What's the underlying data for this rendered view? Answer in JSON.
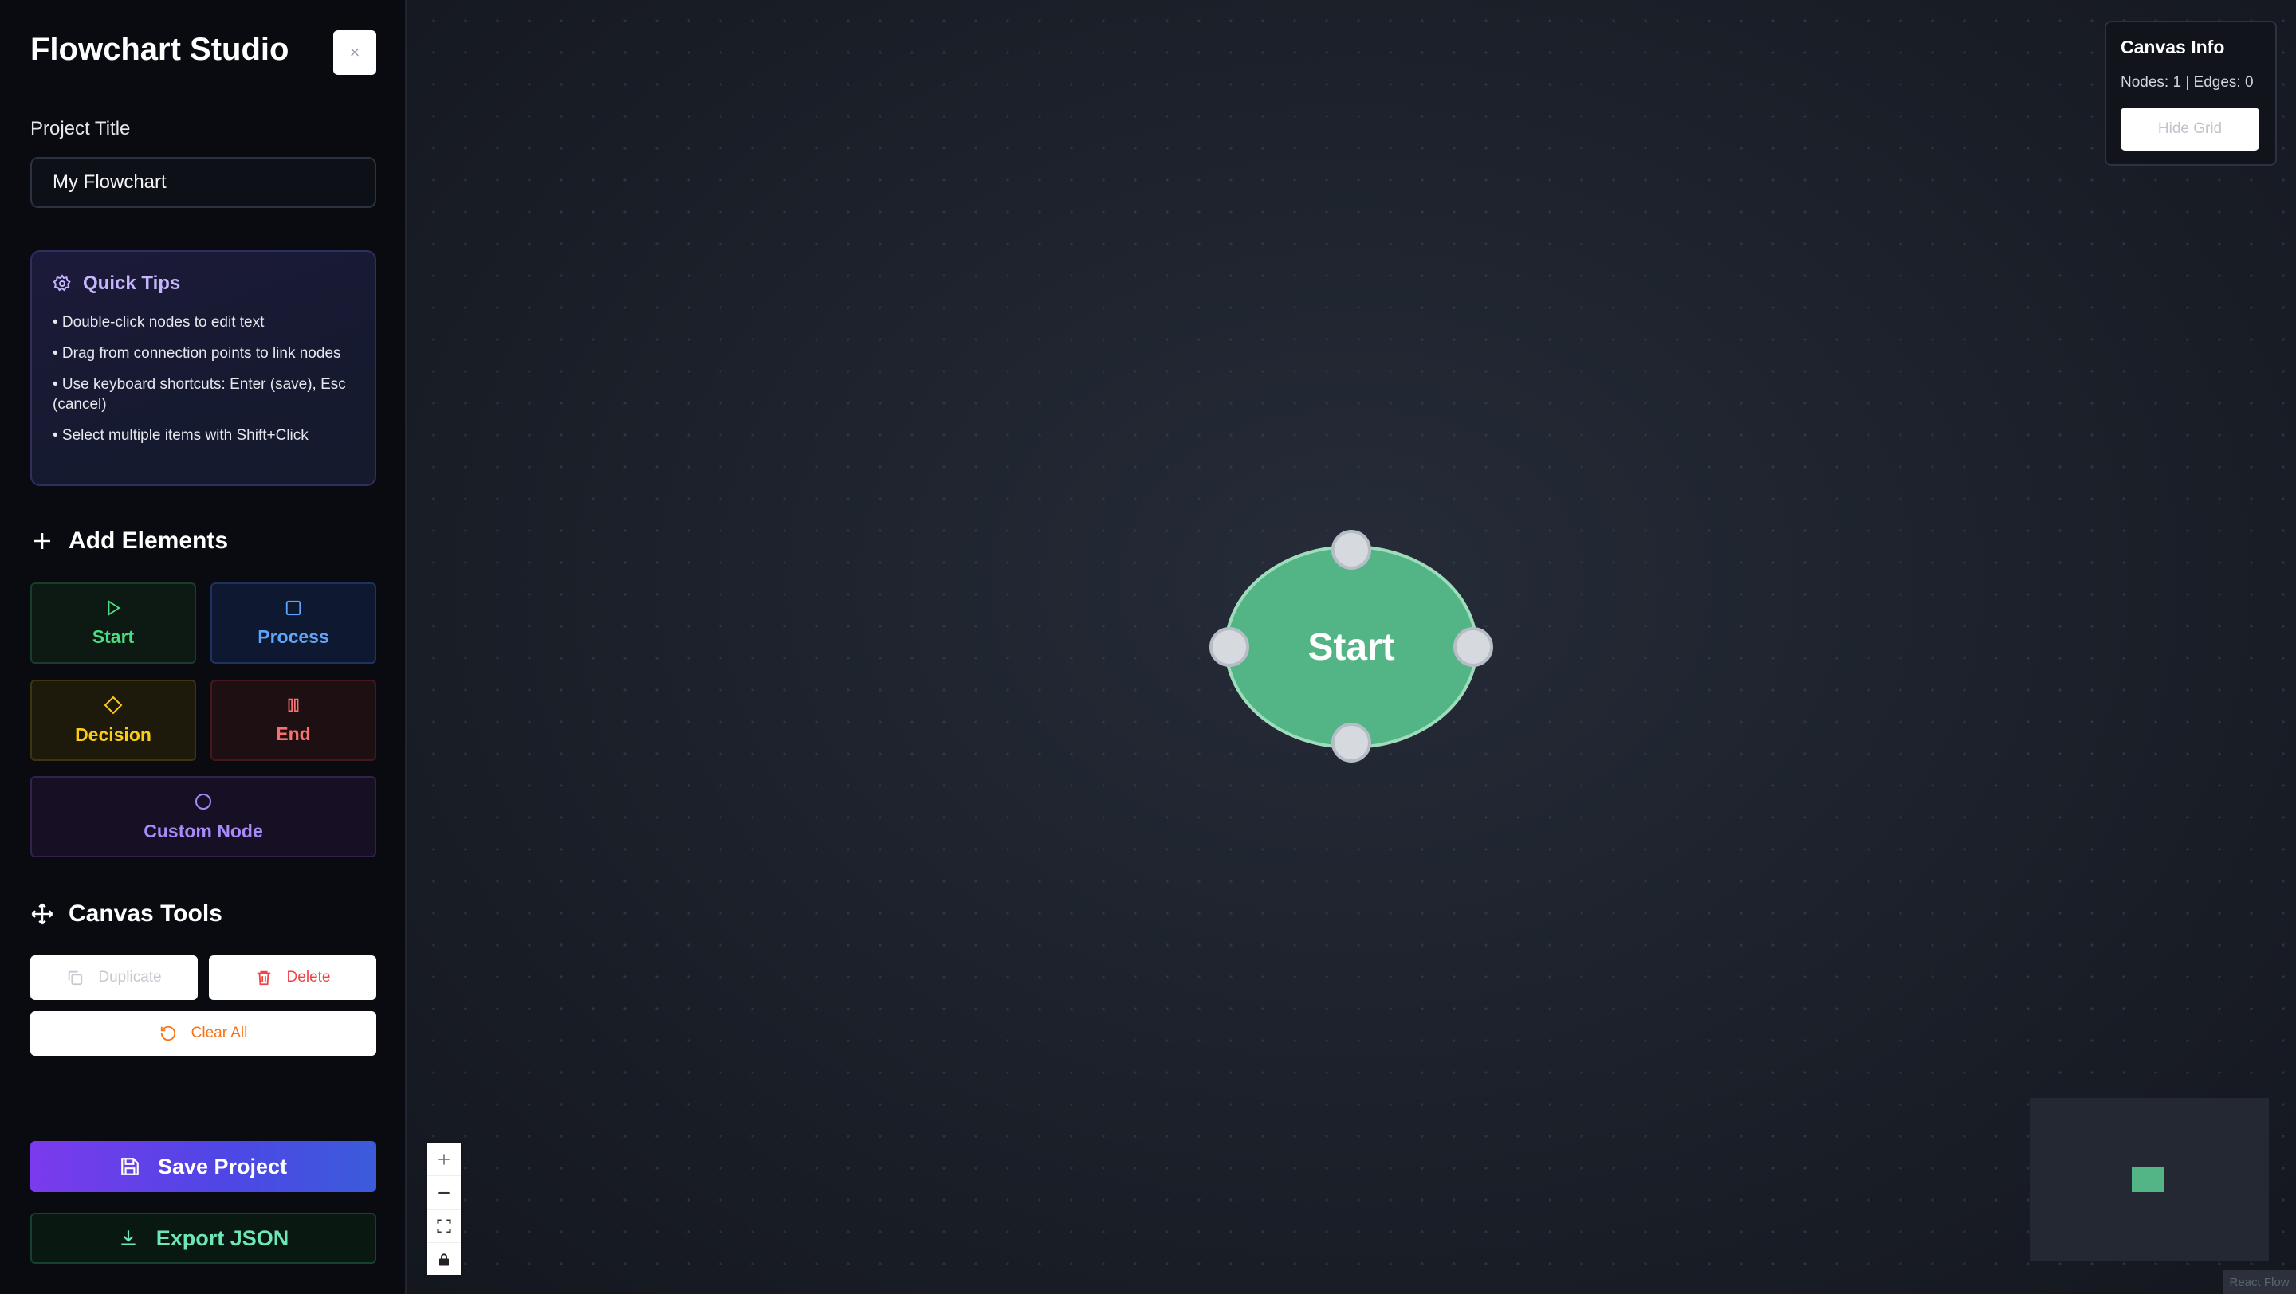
{
  "app": {
    "title": "Flowchart Studio",
    "close_label": "×"
  },
  "project": {
    "label": "Project Title",
    "value": "My Flowchart"
  },
  "tips": {
    "title": "Quick Tips",
    "items": [
      "• Double-click nodes to edit text",
      "• Drag from connection points to link nodes",
      "• Use keyboard shortcuts: Enter (save), Esc (cancel)",
      "• Select multiple items with Shift+Click"
    ]
  },
  "add_elements": {
    "title": "Add Elements",
    "start": "Start",
    "process": "Process",
    "decision": "Decision",
    "end": "End",
    "custom": "Custom Node"
  },
  "canvas_tools": {
    "title": "Canvas Tools",
    "duplicate": "Duplicate",
    "delete": "Delete",
    "clear_all": "Clear All"
  },
  "actions": {
    "save": "Save Project",
    "export": "Export JSON"
  },
  "canvas": {
    "node_label": "Start",
    "info_title": "Canvas Info",
    "info_stats": "Nodes: 1 | Edges: 0",
    "grid_button": "Hide Grid",
    "attribution": "React Flow"
  },
  "colors": {
    "start": "#4ade80",
    "process": "#60a5fa",
    "decision": "#facc15",
    "end": "#f87171",
    "custom": "#a78bfa",
    "node_fill": "#53b586"
  },
  "icons": {
    "tips": "gear-icon",
    "add": "plus-icon",
    "tools": "move-icon",
    "start": "play-icon",
    "process": "square-icon",
    "decision": "diamond-icon",
    "end": "pause-icon",
    "custom": "circle-icon",
    "duplicate": "copy-icon",
    "delete": "trash-icon",
    "clear": "rotate-icon",
    "save": "save-icon",
    "export": "download-icon"
  }
}
